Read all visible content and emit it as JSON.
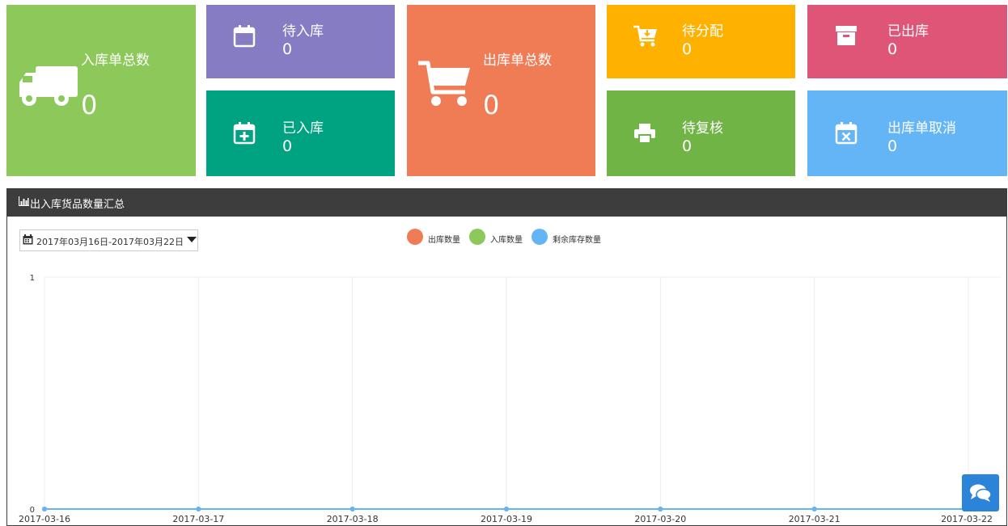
{
  "tiles": {
    "inbound_total": {
      "label": "入库单总数",
      "value": "0",
      "color": "#8cc85a",
      "icon": "truck-icon"
    },
    "pending_inbound": {
      "label": "待入库",
      "value": "0",
      "color": "#857cc4",
      "icon": "calendar-icon"
    },
    "inbounded": {
      "label": "已入库",
      "value": "0",
      "color": "#00a381",
      "icon": "calendar-plus-icon"
    },
    "outbound_total": {
      "label": "出库单总数",
      "value": "0",
      "color": "#f07c56",
      "icon": "cart-icon"
    },
    "pending_allocation": {
      "label": "待分配",
      "value": "0",
      "color": "#ffb100",
      "icon": "cart-download-icon"
    },
    "pending_review": {
      "label": "待复核",
      "value": "0",
      "color": "#70b446",
      "icon": "printer-icon"
    },
    "outbounded": {
      "label": "已出库",
      "value": "0",
      "color": "#df5578",
      "icon": "archive-icon"
    },
    "outbound_cancelled": {
      "label": "出库单取消",
      "value": "0",
      "color": "#64b5f6",
      "icon": "calendar-x-icon"
    }
  },
  "panel": {
    "title": "出入库货品数量汇总",
    "icon": "bar-chart-icon",
    "date_range": "2017年03月16日-2017年03月22日",
    "header_color": "#3d3d3d"
  },
  "chart_data": {
    "type": "line",
    "x": [
      "2017-03-16",
      "2017-03-17",
      "2017-03-18",
      "2017-03-19",
      "2017-03-20",
      "2017-03-21",
      "2017-03-22"
    ],
    "ylim": [
      0,
      1
    ],
    "yticks": [
      "0",
      "1"
    ],
    "grid": true,
    "legend_position": "top-center",
    "series": [
      {
        "name": "出库数量",
        "values": [
          0,
          0,
          0,
          0,
          0,
          0,
          0
        ],
        "color": "#f07c56"
      },
      {
        "name": "入库数量",
        "values": [
          0,
          0,
          0,
          0,
          0,
          0,
          0
        ],
        "color": "#8cc85a"
      },
      {
        "name": "剩余库存数量",
        "values": [
          0,
          0,
          0,
          0,
          0,
          0,
          0
        ],
        "color": "#64b5f6"
      }
    ]
  },
  "chat": {
    "icon": "chat-icon"
  }
}
